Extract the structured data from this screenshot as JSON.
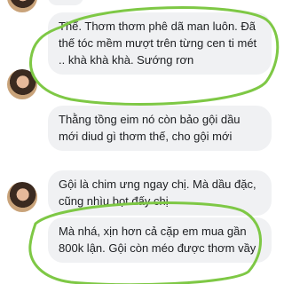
{
  "messages": [
    {
      "text": "Thế. Thơm thơm phê dã man luôn. Đã thế tóc mềm mượt trên từng cen ti mét ..  khà khà khà. Sướng rơn"
    },
    {
      "text": "Thằng tồng eim nó còn bảo gội dầu mới diud gì thơm thế, cho gội mới"
    },
    {
      "text": "Gội là chim ưng ngay chị. Mà dầu đặc, cũng nhìu bọt đấy chị"
    },
    {
      "text": "Mà nhá, xịn hơn cả cặp em mua gần 800k lận. Gội còn méo được thơm vầy"
    }
  ],
  "colors": {
    "bubble": "#f0f1f3",
    "text": "#1c1e21",
    "highlight": "#7ec845"
  }
}
